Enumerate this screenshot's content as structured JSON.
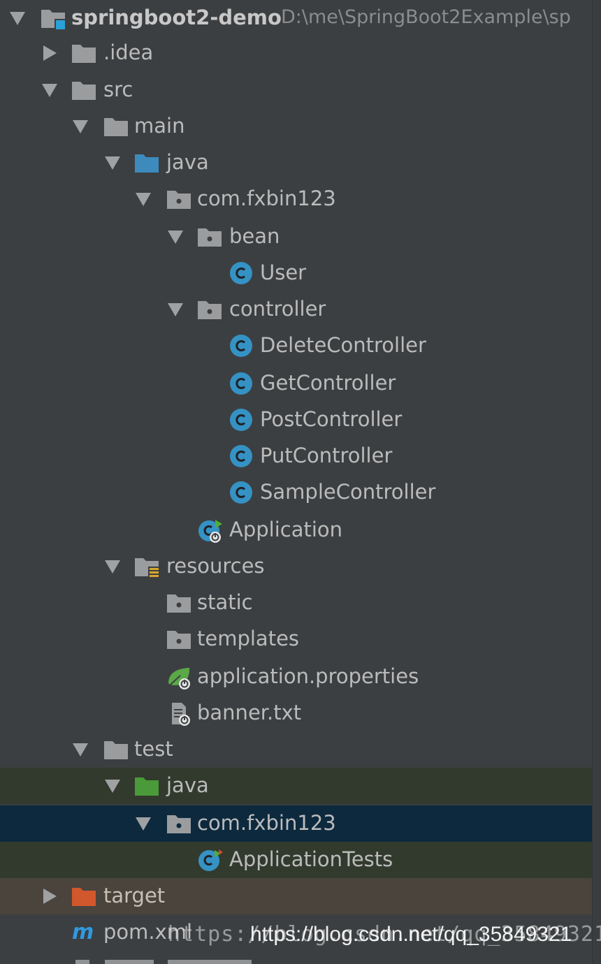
{
  "project": {
    "name": "springboot2-demo",
    "path": "D:\\me\\SpringBoot2Example\\sp"
  },
  "nodes": {
    "idea": ".idea",
    "src": "src",
    "main": "main",
    "main_java": "java",
    "main_pkg": "com.fxbin123",
    "bean": "bean",
    "user": "User",
    "controller": "controller",
    "delete_controller": "DeleteController",
    "get_controller": "GetController",
    "post_controller": "PostController",
    "put_controller": "PutController",
    "sample_controller": "SampleController",
    "application": "Application",
    "resources": "resources",
    "static": "static",
    "templates": "templates",
    "application_properties": "application.properties",
    "banner": "banner.txt",
    "test": "test",
    "test_java": "java",
    "test_pkg": "com.fxbin123",
    "application_tests": "ApplicationTests",
    "target": "target",
    "pom": "pom.xml"
  },
  "watermark": {
    "faint": "https://blog.csdn.net/qq_35849321",
    "overlay": "https://blog.csdn.net/qq_35849321"
  },
  "colors": {
    "panel_background": "#3c3f41",
    "text": "#bbbbbb",
    "folder": "#9a9c9e",
    "source_folder": "#3d8bbd",
    "test_folder": "#4a9a3a",
    "excluded_folder": "#d1572d",
    "class_icon": "#3592c4",
    "selection_active": "#0d293e",
    "selection_inactive": "#323a2d"
  },
  "icons": {
    "module": "module-folder-icon",
    "folder": "folder-icon",
    "package": "package-icon",
    "class": "class-icon",
    "spring_boot_class": "spring-boot-class-icon",
    "spring_properties": "spring-properties-icon",
    "text_file": "text-file-icon",
    "maven": "maven-icon"
  }
}
